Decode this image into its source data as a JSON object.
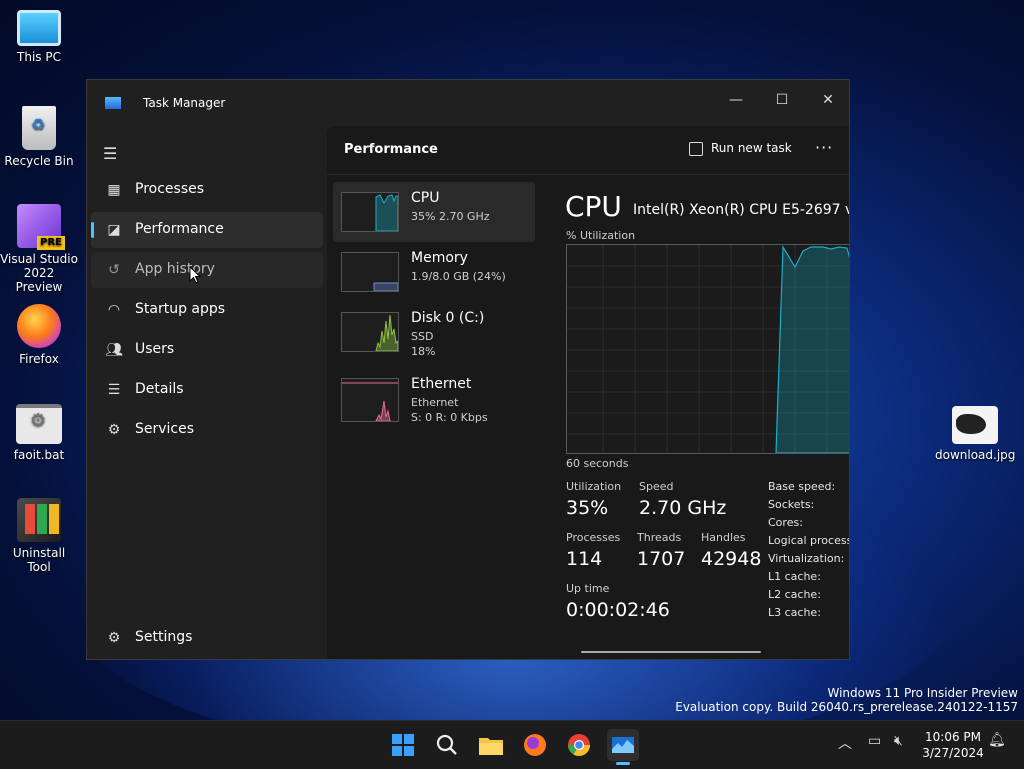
{
  "desktop": {
    "icons": [
      {
        "label": "This PC"
      },
      {
        "label": "Recycle Bin"
      },
      {
        "label": "Visual Studio 2022 Preview",
        "badge": "PRE"
      },
      {
        "label": "Firefox"
      },
      {
        "label": "faoit.bat"
      },
      {
        "label": "Uninstall Tool"
      },
      {
        "label": "download.jpg"
      }
    ],
    "watermark": {
      "line1": "Windows 11 Pro Insider Preview",
      "line2": "Evaluation copy. Build 26040.rs_prerelease.240122-1157"
    }
  },
  "window": {
    "title": "Task Manager",
    "controls": {
      "minimize": "—",
      "maximize": "☐",
      "close": "✕"
    }
  },
  "nav": {
    "menu_icon": "hamburger-icon",
    "items": [
      {
        "label": "Processes",
        "icon": "processes-icon"
      },
      {
        "label": "Performance",
        "icon": "performance-icon"
      },
      {
        "label": "App history",
        "icon": "history-icon"
      },
      {
        "label": "Startup apps",
        "icon": "startup-icon"
      },
      {
        "label": "Users",
        "icon": "users-icon"
      },
      {
        "label": "Details",
        "icon": "details-icon"
      },
      {
        "label": "Services",
        "icon": "services-icon"
      }
    ],
    "settings": "Settings",
    "selected": "Performance"
  },
  "header": {
    "title": "Performance",
    "run_task": "Run new task",
    "more": "···"
  },
  "resources": [
    {
      "name": "CPU",
      "line1": "35%  2.70 GHz",
      "line2": ""
    },
    {
      "name": "Memory",
      "line1": "1.9/8.0 GB (24%)",
      "line2": ""
    },
    {
      "name": "Disk 0 (C:)",
      "line1": "SSD",
      "line2": "18%"
    },
    {
      "name": "Ethernet",
      "line1": "Ethernet",
      "line2": "S: 0  R: 0 Kbps"
    }
  ],
  "cpu": {
    "title": "CPU",
    "model": "Intel(R) Xeon(R) CPU E5-2697 v",
    "util_label": "% Utilization",
    "time_label": "60 seconds",
    "stats": {
      "utilization_label": "Utilization",
      "utilization": "35%",
      "speed_label": "Speed",
      "speed": "2.70 GHz",
      "processes_label": "Processes",
      "processes": "114",
      "threads_label": "Threads",
      "threads": "1707",
      "handles_label": "Handles",
      "handles": "42948",
      "uptime_label": "Up time",
      "uptime": "0:00:02:46"
    },
    "specs": [
      "Base speed:",
      "Sockets:",
      "Cores:",
      "Logical processo",
      "Virtualization:",
      "L1 cache:",
      "L2 cache:",
      "L3 cache:"
    ]
  },
  "colors": {
    "accent": "#4cc2ff",
    "cpu_line": "#17b0c8",
    "memory_line": "#6a8fd8",
    "disk_line": "#8ec63f",
    "ethernet_line": "#e86a9a"
  },
  "taskbar": {
    "apps": [
      "windows-start-icon",
      "search-icon",
      "file-explorer-icon",
      "firefox-icon",
      "chrome-icon",
      "task-manager-icon"
    ],
    "time": "10:06 PM",
    "date": "3/27/2024"
  }
}
